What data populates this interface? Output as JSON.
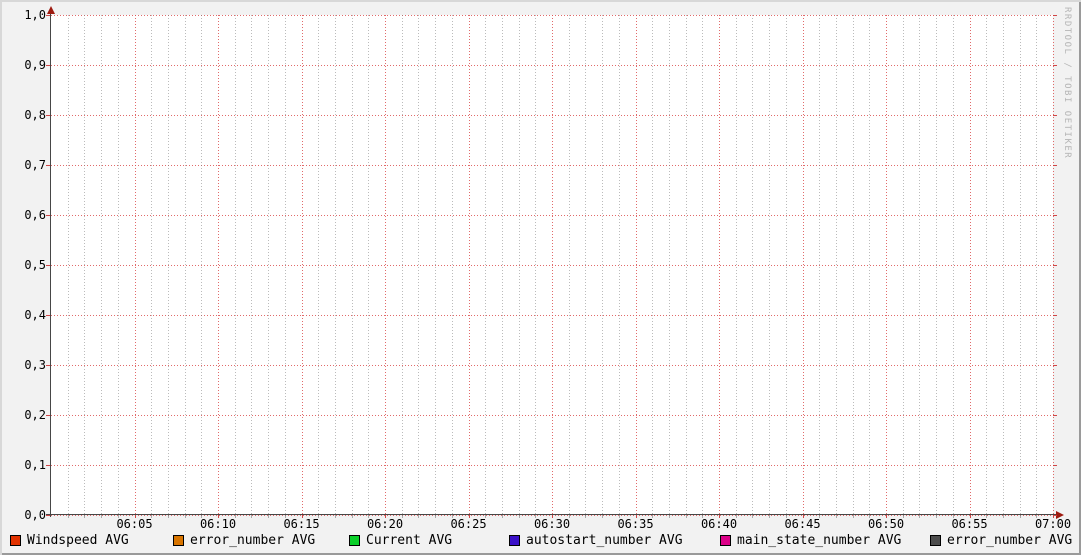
{
  "watermark": "RRDTOOL / TOBI OETIKER",
  "chart_data": {
    "type": "line",
    "title": "",
    "x_axis": {
      "label": "",
      "start": "06:00",
      "end": "07:00",
      "major_tick_interval_minutes": 5,
      "minor_tick_interval_minutes": 1,
      "tick_labels": [
        "06:05",
        "06:10",
        "06:15",
        "06:20",
        "06:25",
        "06:30",
        "06:35",
        "06:40",
        "06:45",
        "06:50",
        "06:55",
        "07:00"
      ]
    },
    "y_axis": {
      "label": "",
      "min": 0,
      "max": 1,
      "major_step": 0.1,
      "decimal_separator": ",",
      "tick_labels": [
        "1,0",
        "0,9",
        "0,8",
        "0,7",
        "0,6",
        "0,5",
        "0,4",
        "0,3",
        "0,2",
        "0,1",
        "0,0"
      ]
    },
    "grid": {
      "style": "dotted",
      "show_major": true,
      "show_minor_vertical": true,
      "major_color": "#dc5050",
      "minor_color": "#787878"
    },
    "axis_color": "#464646",
    "arrow_color": "#9e1b10",
    "legend_position": "bottom",
    "series": [
      {
        "name": "Windspeed AVG",
        "color": "#e23200",
        "values": []
      },
      {
        "name": "error_number AVG",
        "color": "#d97500",
        "values": []
      },
      {
        "name": "Current AVG",
        "color": "#0bd02a",
        "values": []
      },
      {
        "name": "autostart_number AVG",
        "color": "#3a10c8",
        "values": []
      },
      {
        "name": "main_state_number AVG",
        "color": "#dc0088",
        "values": []
      },
      {
        "name": "error_number AVG",
        "color": "#4d4d4d",
        "values": []
      }
    ]
  },
  "legend": {
    "items": [
      {
        "label": "Windspeed AVG",
        "color": "#e23200"
      },
      {
        "label": "error_number AVG",
        "color": "#d97500"
      },
      {
        "label": "Current AVG",
        "color": "#0bd02a"
      },
      {
        "label": "autostart_number AVG",
        "color": "#3a10c8"
      },
      {
        "label": "main_state_number AVG",
        "color": "#dc0088"
      },
      {
        "label": "error_number AVG",
        "color": "#4d4d4d"
      }
    ]
  }
}
